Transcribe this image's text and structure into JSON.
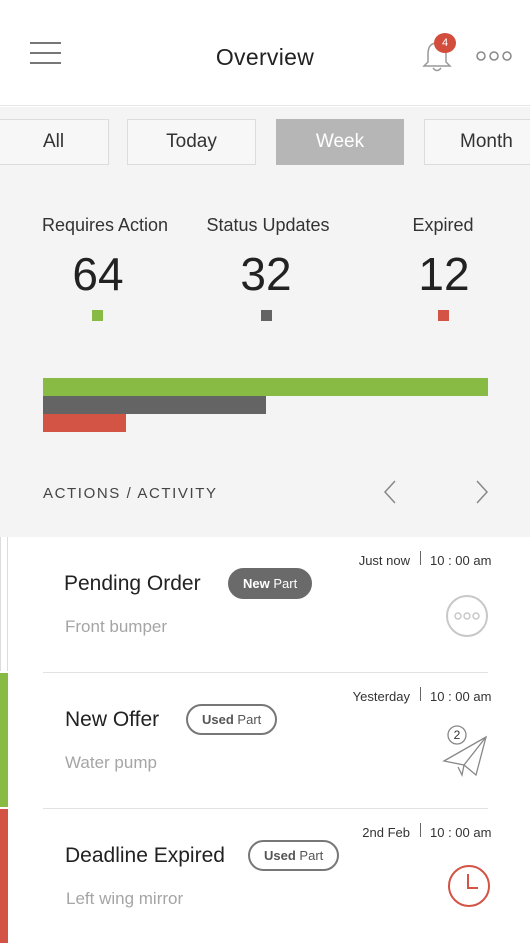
{
  "header": {
    "title": "Overview",
    "notification_count": "4"
  },
  "tabs": [
    {
      "label": "All",
      "active": false
    },
    {
      "label": "Today",
      "active": false
    },
    {
      "label": "Week",
      "active": true
    },
    {
      "label": "Month",
      "active": false
    }
  ],
  "stats": [
    {
      "label": "Requires Action",
      "value": "64",
      "color": "#87bb43"
    },
    {
      "label": "Status Updates",
      "value": "32",
      "color": "#646464"
    },
    {
      "label": "Expired",
      "value": "12",
      "color": "#d35345"
    }
  ],
  "bars": [
    {
      "value": 64,
      "color": "#87bb43"
    },
    {
      "value": 32,
      "color": "#646464"
    },
    {
      "value": 12,
      "color": "#d35345"
    }
  ],
  "section": {
    "title": "ACTIONS / ACTIVITY"
  },
  "items": [
    {
      "title": "Pending Order",
      "subtitle": "Front bumper",
      "date": "Just now",
      "time": "10 : 00 am",
      "tag_strong": "New",
      "tag_rest": "Part",
      "tag_style": "dark",
      "icon": "more-circle-icon",
      "stripe_color": "#ffffff"
    },
    {
      "title": "New Offer",
      "subtitle": "Water pump",
      "date": "Yesterday",
      "time": "10 : 00 am",
      "tag_strong": "Used",
      "tag_rest": "Part",
      "tag_style": "light",
      "icon": "paper-plane-icon",
      "icon_count": "2",
      "stripe_color": "#87bb43"
    },
    {
      "title": "Deadline Expired",
      "subtitle": "Left wing mirror",
      "date": "2nd Feb",
      "time": "10 : 00 am",
      "tag_strong": "Used",
      "tag_rest": "Part",
      "tag_style": "light",
      "icon": "clock-icon",
      "stripe_color": "#d35345"
    }
  ]
}
